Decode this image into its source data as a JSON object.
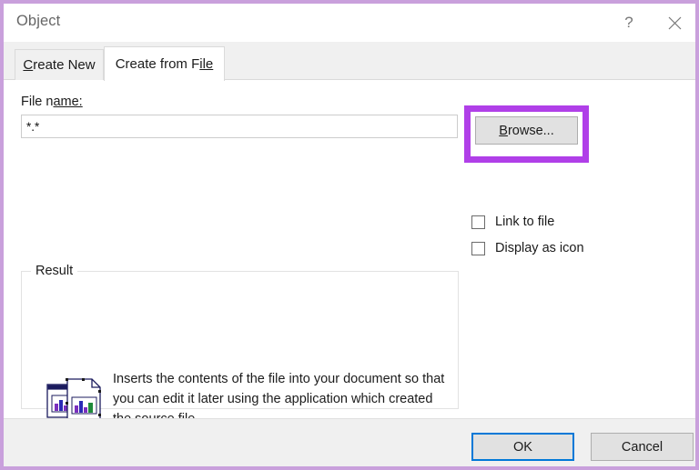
{
  "dialog": {
    "title": "Object",
    "help_icon": "question-mark-icon",
    "close_icon": "close-icon"
  },
  "tabs": [
    {
      "label_pre": "C",
      "label_post": "reate New",
      "label": "Create New",
      "selected": false
    },
    {
      "label_pre": "Create from F",
      "label_post": "ile",
      "label": "Create from File",
      "selected": true
    }
  ],
  "form": {
    "filename_label_pre": "File n",
    "filename_label_post": "ame:",
    "filename_label": "File name:",
    "filename_value": "*.*",
    "filename_placeholder": "",
    "browse_label_pre": "B",
    "browse_label_post": "rowse...",
    "browse_label": "Browse..."
  },
  "checkboxes": [
    {
      "label_pre": "Link",
      "label_post": " to file",
      "label": "Link to file",
      "checked": false
    },
    {
      "label_pre": "Display a",
      "label_post": "s icon",
      "label": "Display as icon",
      "checked": false
    }
  ],
  "result": {
    "legend": "Result",
    "icon": "document-chart-stack-icon",
    "description": "Inserts the contents of the file into your document so that you can edit it later using the application which created the source file."
  },
  "footer": {
    "ok_label": "OK",
    "cancel_label": "Cancel"
  },
  "annotation": {
    "target": "browse-button",
    "highlight_color": "#b03fe8"
  },
  "colors": {
    "outer_frame": "#c9a0dc",
    "highlight": "#b03fe8",
    "focus_blue": "#0078d7",
    "dialog_bg": "#ffffff",
    "footer_bg": "#f0f0f0",
    "tabstrip_bg": "#f0f0f0",
    "button_bg": "#e1e1e1"
  }
}
